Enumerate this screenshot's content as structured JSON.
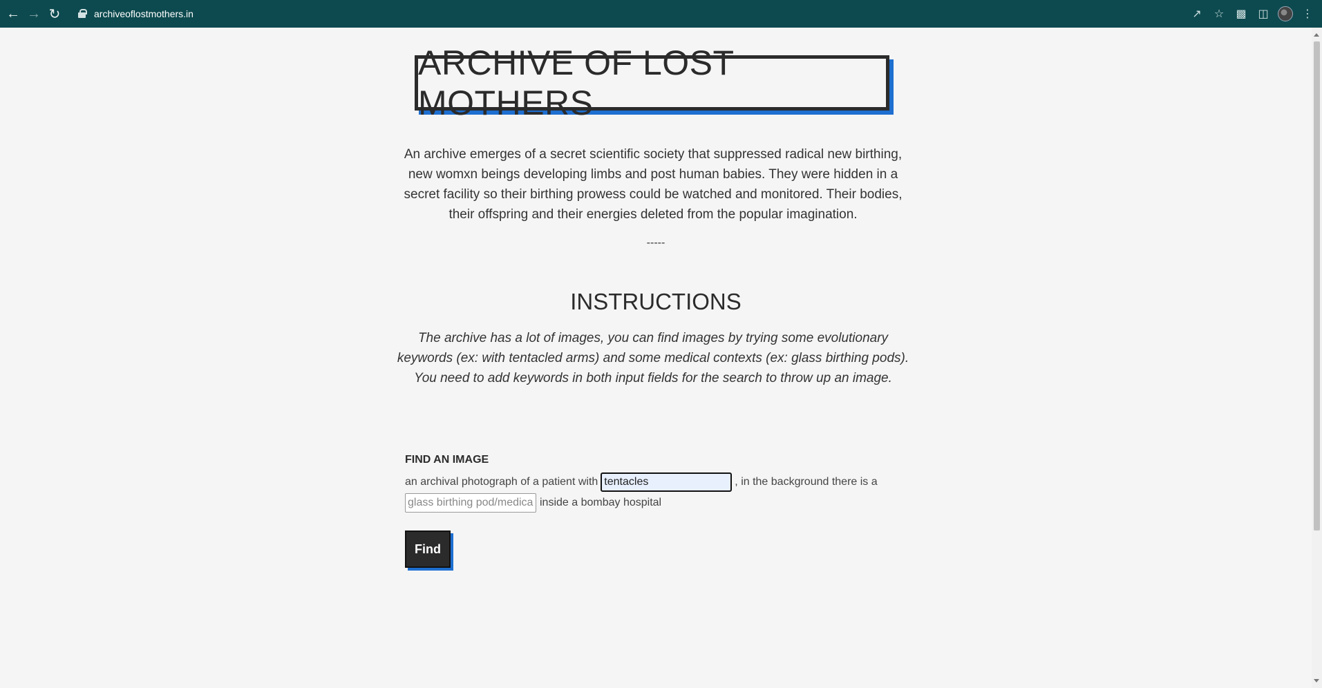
{
  "browser": {
    "url": "archiveoflostmothers.in",
    "icons": [
      "back-arrow-icon",
      "forward-arrow-icon",
      "reload-icon",
      "lock-icon",
      "share-icon",
      "star-icon",
      "extensions-puzzle-icon",
      "side-panel-icon",
      "profile-avatar",
      "menu-dots-icon"
    ]
  },
  "header": {
    "title": "ARCHIVE OF LOST MOTHERS"
  },
  "intro": {
    "text": "An archive emerges of a secret scientific society that suppressed radical new birthing, new womxn beings developing limbs and post human babies. They were hidden in a secret facility so their birthing prowess could be watched and monitored. Their bodies, their offspring and their energies deleted from the popular imagination."
  },
  "divider": "-----",
  "instructions": {
    "title": "INSTRUCTIONS",
    "body": "The archive has a lot of images, you can find images by trying some evolutionary keywords (ex: with tentacled arms) and some medical contexts (ex: glass birthing pods). You need to add keywords in both input fields for the search to throw up an image."
  },
  "find": {
    "title": "FIND AN IMAGE",
    "prefix": "an archival photograph of a patient with",
    "keyword_value": "tentacles",
    "middle": ", in the background there is a",
    "context_placeholder": "glass birthing pod/medical",
    "suffix": "inside a bombay hospital",
    "button_label": "Find"
  },
  "colors": {
    "chrome": "#0d4a4f",
    "accent_shadow": "#1e6fd0",
    "dark": "#2b2b2b",
    "background": "#f5f5f5"
  }
}
